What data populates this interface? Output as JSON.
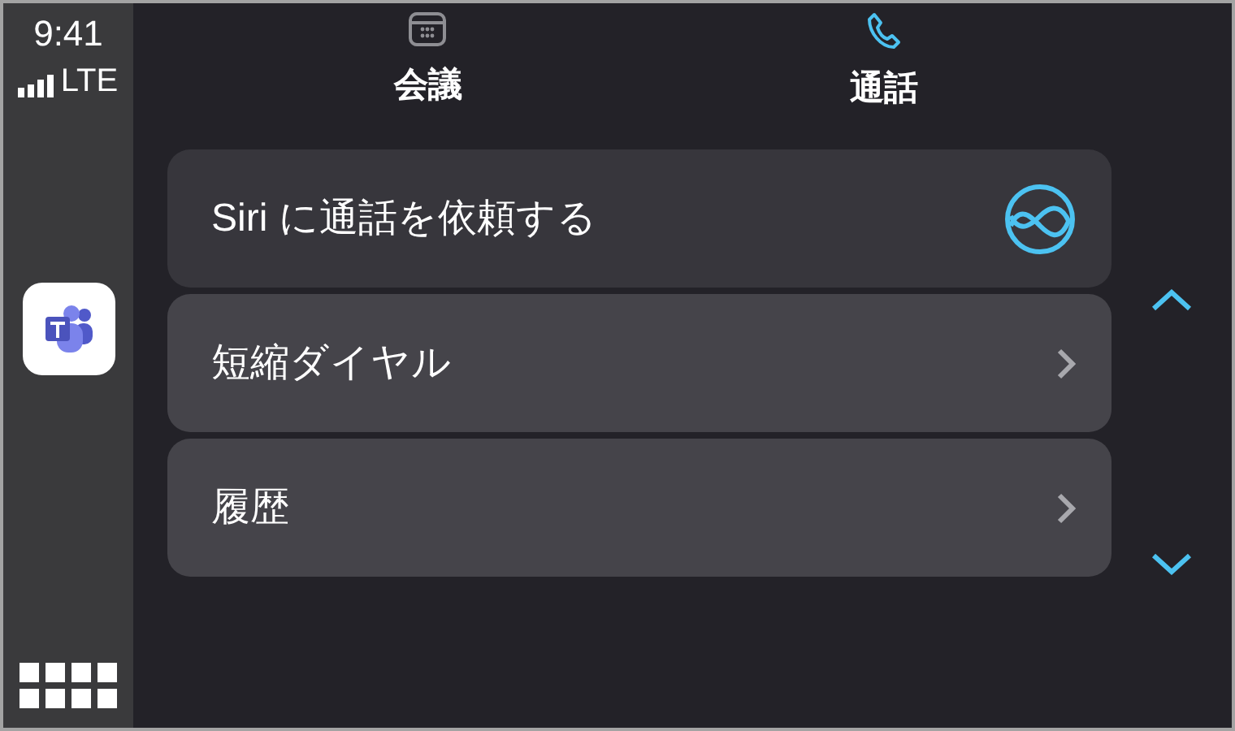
{
  "status": {
    "time": "9:41",
    "network": "LTE"
  },
  "tabs": [
    {
      "label": "会議",
      "selected": false,
      "kind": "calendar"
    },
    {
      "label": "通話",
      "selected": true,
      "kind": "phone"
    }
  ],
  "items": [
    {
      "label": "Siri に通話を依頼する",
      "kind": "siri",
      "selected": false
    },
    {
      "label": "短縮ダイヤル",
      "kind": "link",
      "selected": true
    },
    {
      "label": "履歴",
      "kind": "link",
      "selected": true
    }
  ]
}
